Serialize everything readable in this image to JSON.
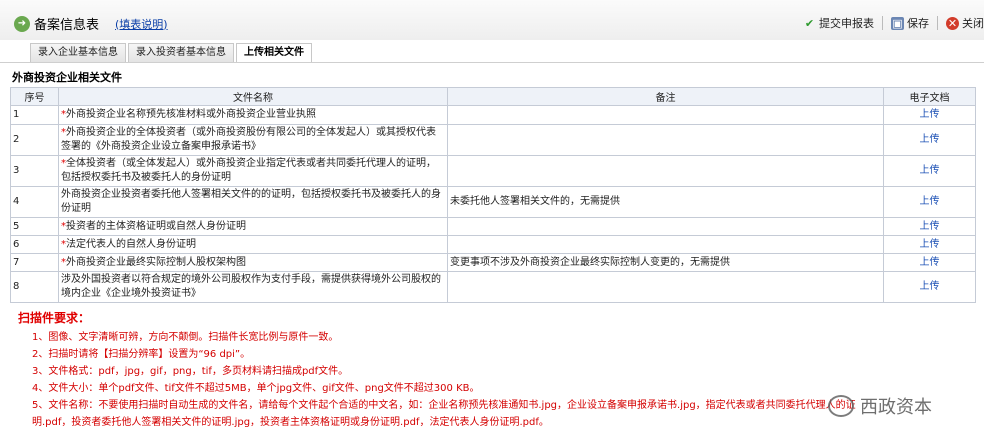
{
  "header": {
    "title": "备案信息表",
    "help_link": "(填表说明)",
    "toolbar": {
      "submit": "提交申报表",
      "save": "保存",
      "close": "关闭"
    }
  },
  "tabs": [
    {
      "label": "录入企业基本信息"
    },
    {
      "label": "录入投资者基本信息"
    },
    {
      "label": "上传相关文件"
    }
  ],
  "active_tab": "上传相关文件",
  "section_title": "外商投资企业相关文件",
  "table": {
    "columns": [
      "序号",
      "文件名称",
      "备注",
      "电子文档"
    ],
    "rows": [
      {
        "no": "1",
        "required": "*",
        "name": "外商投资企业名称预先核准材料或外商投资企业营业执照",
        "note": "",
        "action": "上传"
      },
      {
        "no": "2",
        "required": "*",
        "name": "外商投资企业的全体投资者（或外商投资股份有限公司的全体发起人）或其授权代表签署的《外商投资企业设立备案申报承诺书》",
        "note": "",
        "action": "上传"
      },
      {
        "no": "3",
        "required": "*",
        "name": "全体投资者（或全体发起人）或外商投资企业指定代表或者共同委托代理人的证明，包括授权委托书及被委托人的身份证明",
        "note": "",
        "action": "上传"
      },
      {
        "no": "4",
        "required": "",
        "name": "外商投资企业投资者委托他人签署相关文件的的证明，包括授权委托书及被委托人的身份证明",
        "note": "未委托他人签署相关文件的，无需提供",
        "action": "上传"
      },
      {
        "no": "5",
        "required": "*",
        "name": "投资者的主体资格证明或自然人身份证明",
        "note": "",
        "action": "上传"
      },
      {
        "no": "6",
        "required": "*",
        "name": "法定代表人的自然人身份证明",
        "note": "",
        "action": "上传"
      },
      {
        "no": "7",
        "required": "*",
        "name": "外商投资企业最终实际控制人股权架构图",
        "note": "变更事项不涉及外商投资企业最终实际控制人变更的，无需提供",
        "action": "上传"
      },
      {
        "no": "8",
        "required": "",
        "name": "涉及外国投资者以符合规定的境外公司股权作为支付手段，需提供获得境外公司股权的境内企业《企业境外投资证书》",
        "note": "",
        "action": "上传"
      }
    ]
  },
  "requirements": {
    "title": "扫描件要求：",
    "items": [
      "1、图像、文字清晰可辨，方向不颠倒。扫描件长宽比例与原件一致。",
      "2、扫描时请将【扫描分辨率】设置为“96 dpi”。",
      "3、文件格式：pdf，jpg，gif，png，tif，多页材料请扫描成pdf文件。",
      "4、文件大小：单个pdf文件、tif文件不超过5MB，单个jpg文件、gif文件、png文件不超过300 KB。",
      "5、文件名称：不要使用扫描时自动生成的文件名，请给每个文件起个合适的中文名，如：企业名称预先核准通知书.jpg，企业设立备案申报承诺书.jpg，指定代表或者共同委托代理人的证",
      "明.pdf，投资者委托他人签署相关文件的证明.jpg，投资者主体资格证明或身份证明.pdf，法定代表人身份证明.pdf。"
    ]
  },
  "watermark": "西政资本",
  "icons": {
    "title": "document-icon",
    "submit": "check-icon",
    "save": "save-icon",
    "close": "close-icon"
  },
  "colors": {
    "required_mark": "#e00000",
    "link": "#1a4fb4",
    "header_bg": "#eef2f8"
  }
}
